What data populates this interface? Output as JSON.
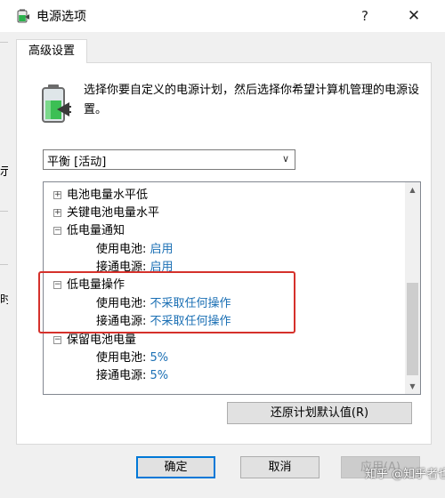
{
  "window": {
    "title": "电源选项",
    "help_glyph": "?",
    "close_glyph": "✕"
  },
  "background": {
    "side_chars": [
      "示",
      "时"
    ]
  },
  "tab": {
    "label": "高级设置"
  },
  "description": "选择你要自定义的电源计划，然后选择你希望计算机管理的电源设置。",
  "plan_select": {
    "value": "平衡 [活动]",
    "icon": "chevron-down-icon"
  },
  "tree": {
    "items": [
      {
        "expander": "+",
        "label": "电池电量水平低"
      },
      {
        "expander": "+",
        "label": "关键电池电量水平"
      },
      {
        "expander": "−",
        "label": "低电量通知"
      },
      {
        "label": "使用电池: ",
        "value": "启用"
      },
      {
        "label": "接通电源: ",
        "value": "启用"
      },
      {
        "expander": "−",
        "label": "低电量操作"
      },
      {
        "label": "使用电池: ",
        "value": "不采取任何操作"
      },
      {
        "label": "接通电源: ",
        "value": "不采取任何操作"
      },
      {
        "expander": "−",
        "label": "保留电池电量"
      },
      {
        "label": "使用电池: ",
        "value": "5%"
      },
      {
        "label": "接通电源: ",
        "value": "5%"
      }
    ]
  },
  "buttons": {
    "restore": "还原计划默认值(R)",
    "ok": "确定",
    "cancel": "取消",
    "apply": "应用(A)"
  },
  "watermark": "知乎 @知乎者也",
  "colors": {
    "link": "#1a6fb4",
    "highlight": "#d5312b",
    "focus_border": "#0078d7"
  }
}
